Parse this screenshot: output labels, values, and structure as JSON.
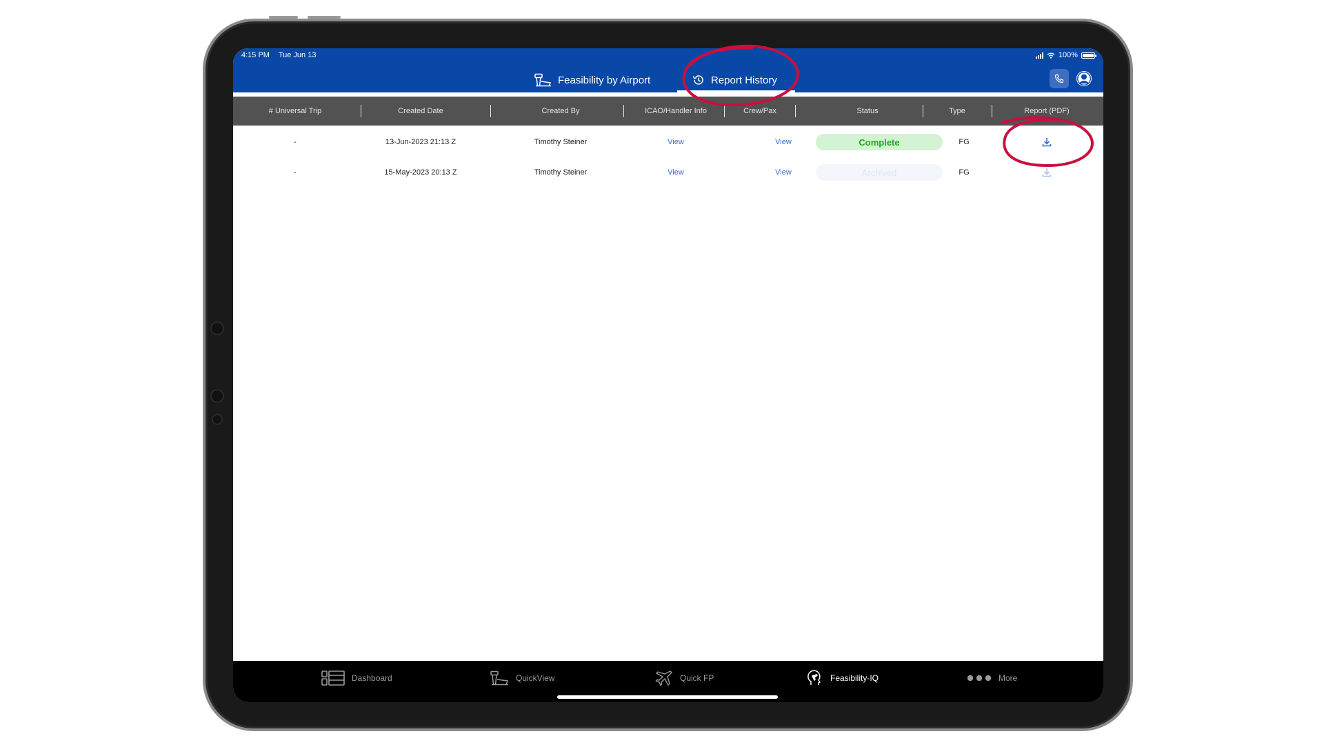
{
  "status_bar": {
    "time": "4:15 PM",
    "date": "Tue Jun 13",
    "battery": "100%"
  },
  "tabs": [
    {
      "label": "Feasibility by Airport",
      "icon": "airport-tower-icon",
      "active": false
    },
    {
      "label": "Report History",
      "icon": "history-icon",
      "active": true
    }
  ],
  "table": {
    "columns": [
      "# Universal Trip",
      "Created Date",
      "Created By",
      "ICAO/Handler Info",
      "Crew/Pax",
      "Status",
      "Type",
      "Report (PDF)"
    ],
    "rows": [
      {
        "trip": "-",
        "created_date": "13-Jun-2023 21:13 Z",
        "created_by": "Timothy Steiner",
        "icao": "View",
        "crew": "View",
        "status": "Complete",
        "type": "FG",
        "report_icon": "download-icon"
      },
      {
        "trip": "-",
        "created_date": "15-May-2023 20:13 Z",
        "created_by": "Timothy Steiner",
        "icao": "View",
        "crew": "View",
        "status": "Archived",
        "type": "FG",
        "report_icon": "download-icon"
      }
    ]
  },
  "bottom_nav": [
    {
      "label": "Dashboard",
      "icon": "dashboard-icon",
      "active": false
    },
    {
      "label": "QuickView",
      "icon": "airport-tower-icon",
      "active": false
    },
    {
      "label": "Quick FP",
      "icon": "airplane-icon",
      "active": false
    },
    {
      "label": "Feasibility-IQ",
      "icon": "head-plane-icon",
      "active": true
    },
    {
      "label": "More",
      "icon": "more-dots-icon",
      "active": false
    }
  ],
  "colors": {
    "brand_blue": "#0a48a7",
    "header_gray": "#525252",
    "complete_green": "#1fa81f",
    "annotation_red": "#c8103e"
  }
}
